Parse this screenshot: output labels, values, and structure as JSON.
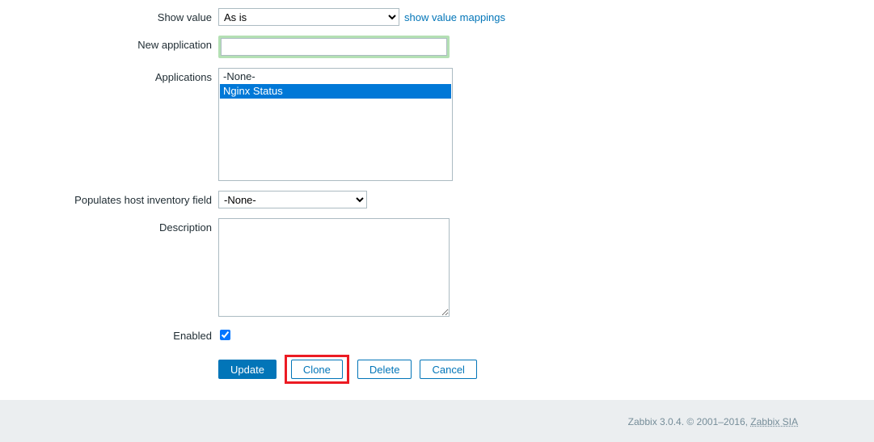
{
  "form": {
    "show_value": {
      "label": "Show value",
      "selected": "As is",
      "link_text": "show value mappings"
    },
    "new_application": {
      "label": "New application",
      "value": ""
    },
    "applications": {
      "label": "Applications",
      "items": [
        {
          "label": "-None-",
          "selected": false
        },
        {
          "label": "Nginx Status",
          "selected": true
        }
      ]
    },
    "populates_inventory": {
      "label": "Populates host inventory field",
      "selected": "-None-"
    },
    "description": {
      "label": "Description",
      "value": ""
    },
    "enabled": {
      "label": "Enabled",
      "checked": true
    },
    "buttons": {
      "update": "Update",
      "clone": "Clone",
      "delete": "Delete",
      "cancel": "Cancel"
    }
  },
  "footer": {
    "text_prefix": "Zabbix 3.0.4. © 2001–2016, ",
    "link_text": "Zabbix SIA"
  }
}
